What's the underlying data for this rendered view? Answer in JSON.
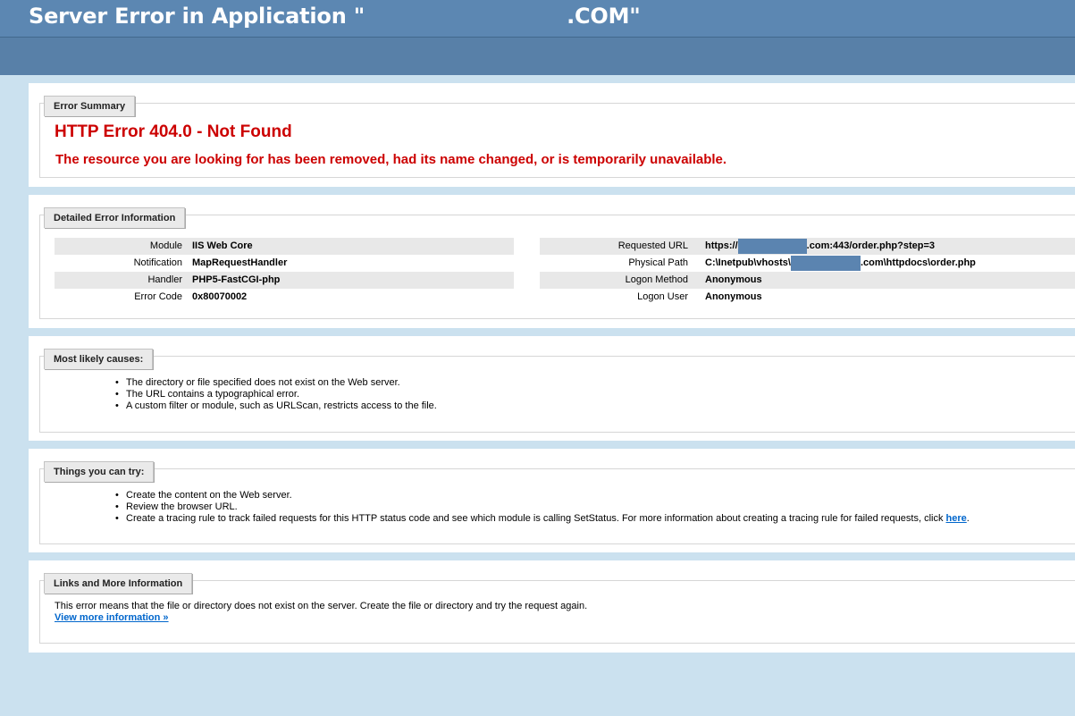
{
  "header": {
    "title": "Server Error in Application \"",
    "title_suffix": ".COM\""
  },
  "summary": {
    "tab": "Error Summary",
    "heading": "HTTP Error 404.0 - Not Found",
    "message": "The resource you are looking for has been removed, had its name changed, or is temporarily unavailable."
  },
  "details": {
    "tab": "Detailed Error Information",
    "left": [
      {
        "label": "Module",
        "value": "IIS Web Core"
      },
      {
        "label": "Notification",
        "value": "MapRequestHandler"
      },
      {
        "label": "Handler",
        "value": "PHP5-FastCGI-php"
      },
      {
        "label": "Error Code",
        "value": "0x80070002"
      }
    ],
    "right": [
      {
        "label": "Requested URL",
        "value_pre": "https://",
        "value_post": ".com:443/order.php?step=3"
      },
      {
        "label": "Physical Path",
        "value_pre": "C:\\Inetpub\\vhosts\\",
        "value_post": ".com\\httpdocs\\order.php"
      },
      {
        "label": "Logon Method",
        "value": "Anonymous"
      },
      {
        "label": "Logon User",
        "value": "Anonymous"
      }
    ]
  },
  "causes": {
    "tab": "Most likely causes:",
    "items": [
      "The directory or file specified does not exist on the Web server.",
      "The URL contains a typographical error.",
      "A custom filter or module, such as URLScan, restricts access to the file."
    ]
  },
  "try": {
    "tab": "Things you can try:",
    "items": [
      "Create the content on the Web server.",
      "Review the browser URL."
    ],
    "last_item": "Create a tracing rule to track failed requests for this HTTP status code and see which module is calling SetStatus. For more information about creating a tracing rule for failed requests, click ",
    "link": "here",
    "last_item_end": "."
  },
  "links": {
    "tab": "Links and More Information",
    "text": "This error means that the file or directory does not exist on the server. Create the file or directory and try the request again.",
    "more_link": "View more information »"
  }
}
